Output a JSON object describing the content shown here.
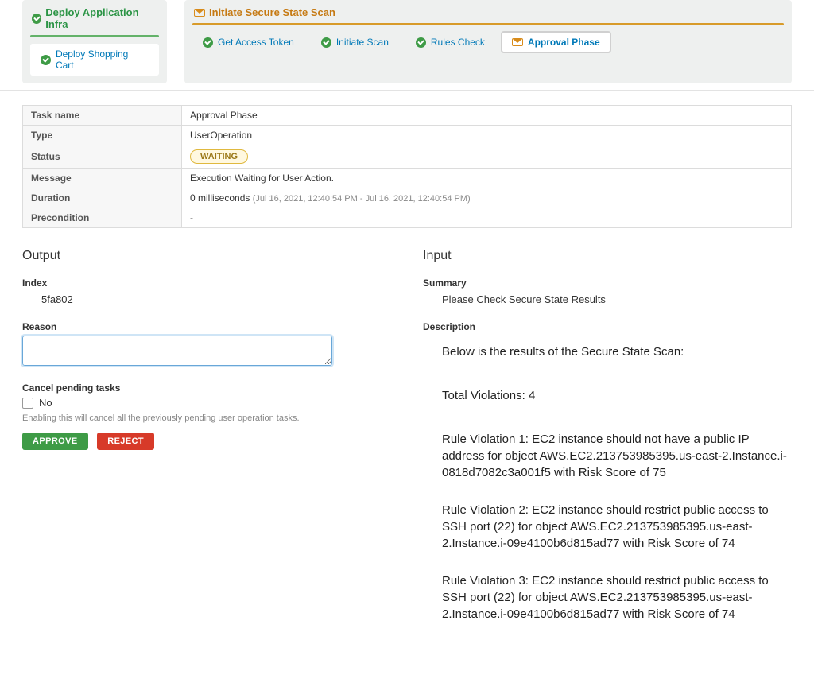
{
  "stages": {
    "deploy_infra": {
      "title": "Deploy Application Infra",
      "tasks": [
        "Deploy Shopping Cart"
      ]
    },
    "scan": {
      "title": "Initiate Secure State Scan",
      "tasks": [
        "Get Access Token",
        "Initiate Scan",
        "Rules Check",
        "Approval Phase"
      ]
    }
  },
  "details": {
    "labels": {
      "task_name": "Task name",
      "type": "Type",
      "status": "Status",
      "message": "Message",
      "duration": "Duration",
      "precondition": "Precondition"
    },
    "task_name": "Approval Phase",
    "type": "UserOperation",
    "status_badge": "WAITING",
    "message": "Execution Waiting for User Action.",
    "duration": "0 milliseconds",
    "duration_ts": "(Jul 16, 2021, 12:40:54 PM - Jul 16, 2021, 12:40:54 PM)",
    "precondition": "-"
  },
  "output": {
    "heading": "Output",
    "index_label": "Index",
    "index_value": "5fa802",
    "reason_label": "Reason",
    "reason_value": "",
    "cancel_label": "Cancel pending tasks",
    "cancel_option": "No",
    "cancel_helper": "Enabling this will cancel all the previously pending user operation tasks.",
    "approve_label": "APPROVE",
    "reject_label": "REJECT"
  },
  "input": {
    "heading": "Input",
    "summary_label": "Summary",
    "summary_value": "Please Check Secure State Results",
    "description_label": "Description",
    "description_lines": [
      "Below is the results of the Secure State Scan:",
      "Total Violations: 4",
      "Rule Violation 1: EC2 instance should not have a public IP address for object AWS.EC2.213753985395.us-east-2.Instance.i-0818d7082c3a001f5 with Risk Score of 75",
      "Rule Violation 2: EC2 instance should restrict public access to SSH port (22) for object AWS.EC2.213753985395.us-east-2.Instance.i-09e4100b6d815ad77 with Risk Score of 74",
      "Rule Violation 3: EC2 instance should restrict public access to SSH port (22) for object AWS.EC2.213753985395.us-east-2.Instance.i-09e4100b6d815ad77 with Risk Score of 74"
    ]
  }
}
